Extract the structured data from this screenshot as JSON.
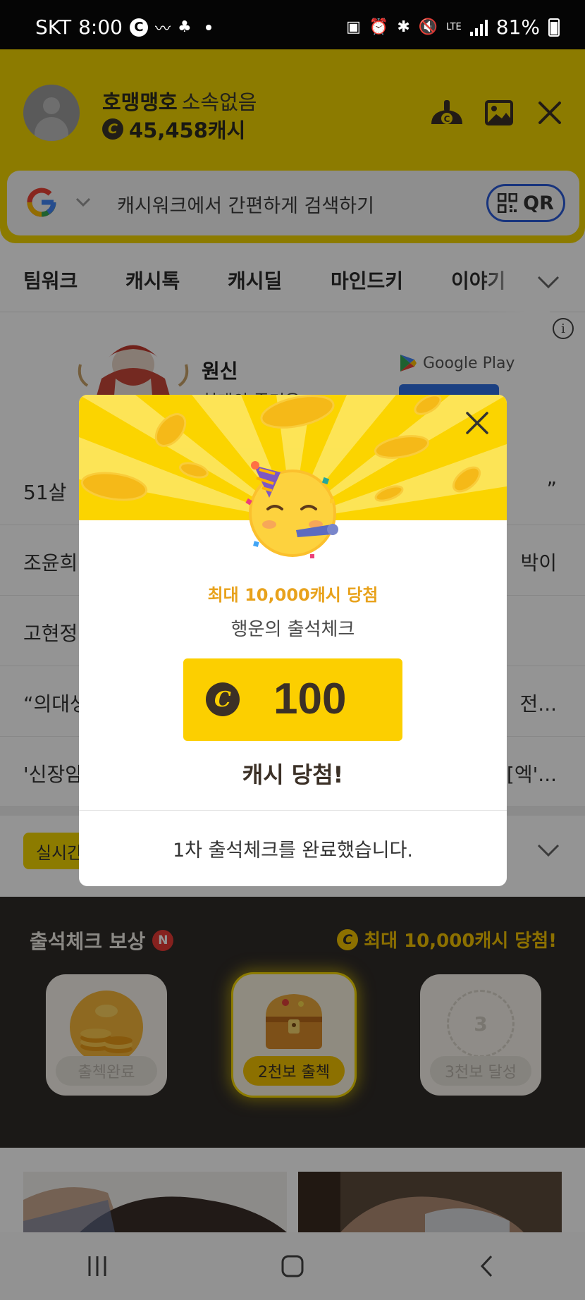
{
  "status_bar": {
    "carrier": "SKT",
    "time": "8:00",
    "network": "LTE",
    "battery": "81%"
  },
  "header": {
    "username": "호맹맹호",
    "affiliation": "소속없음",
    "cash": "45,458캐시",
    "icons": [
      "cash-hat-icon",
      "image-icon",
      "close-icon"
    ]
  },
  "search": {
    "engine": "G",
    "placeholder": "캐시워크에서 간편하게 검색하기",
    "qr_label": "QR"
  },
  "tabs": [
    "팀워크",
    "캐시톡",
    "캐시딜",
    "마인드키",
    "이야기"
  ],
  "ad": {
    "title": "원신",
    "subtitle": "천개의 즐거움",
    "store": "Google Play"
  },
  "news": [
    {
      "left": "51살 ",
      "right": "”"
    },
    {
      "left": "조윤희",
      "right": "박이"
    },
    {
      "left": "고현정",
      "right": ""
    },
    {
      "left": "“의대생",
      "right": "전..."
    },
    {
      "left": "'신장암",
      "right": "[엑'..."
    }
  ],
  "live_badge": "실시간",
  "attendance": {
    "title": "출석체크 보상",
    "new_badge": "N",
    "max_reward": "최대 10,000캐시 당첨!",
    "cards": [
      {
        "label": "출첵완료",
        "state": "done"
      },
      {
        "label": "2천보 출첵",
        "state": "active"
      },
      {
        "label": "3천보 달성",
        "number": "3",
        "state": "locked"
      }
    ]
  },
  "modal": {
    "subtitle": "최대 10,000캐시 당첨",
    "title": "행운의 출석체크",
    "coin_symbol": "C",
    "amount": "100",
    "won": "캐시 당첨!",
    "footer": "1차 출석체크를 완료했습니다."
  },
  "colors": {
    "brand_yellow": "#f2d400",
    "reward_yellow": "#fccf00",
    "accent_orange": "#e8a21c",
    "dark_brown": "#3b3026",
    "qr_border": "#2a5bd7"
  }
}
